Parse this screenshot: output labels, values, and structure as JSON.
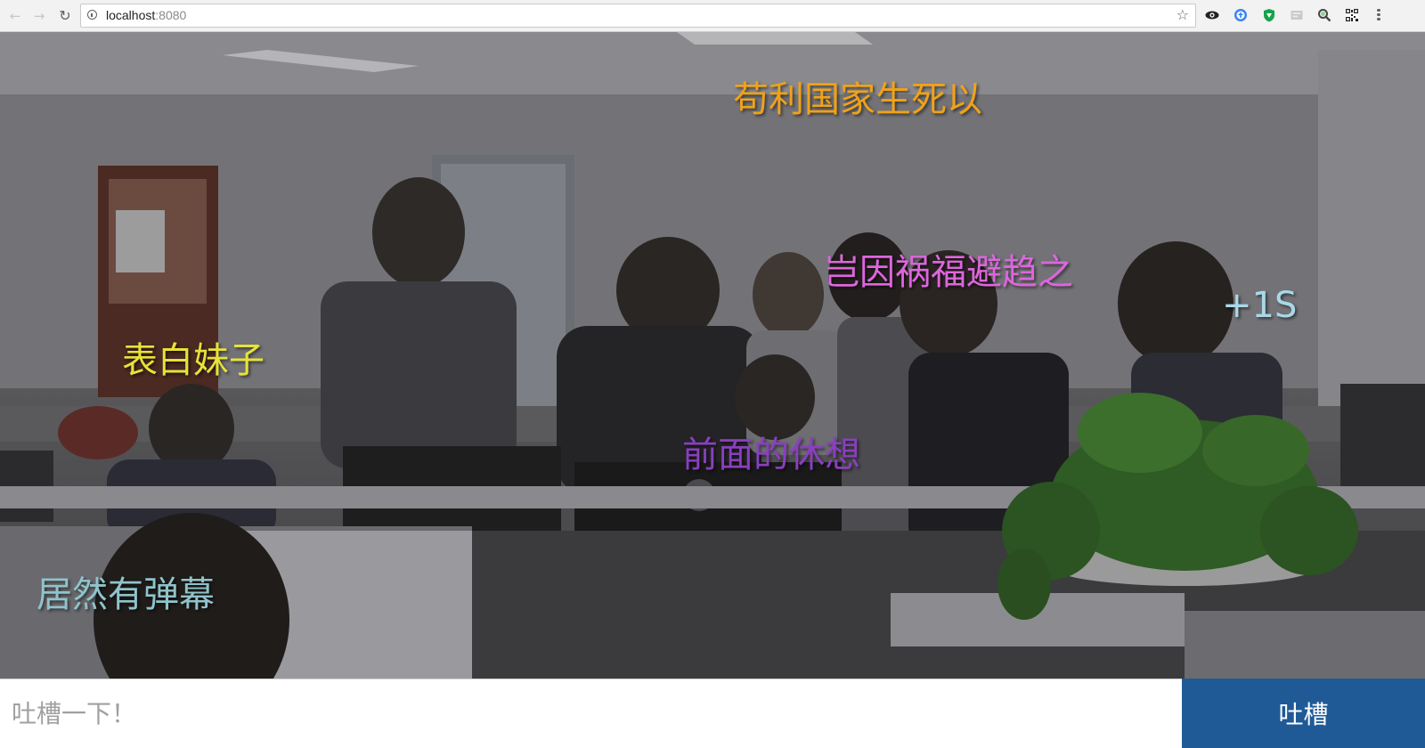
{
  "browser": {
    "address": "localhost",
    "port": ":8080",
    "star_icon": "star-icon",
    "extensions": [
      "eye-icon",
      "translate-icon",
      "shield-icon",
      "extension-icon",
      "zoom-icon",
      "qr-code-icon"
    ]
  },
  "danmaku": [
    {
      "text": "苟利国家生死以",
      "color": "#f0a21a"
    },
    {
      "text": "岂因祸福避趋之",
      "color": "#dd66dd"
    },
    {
      "text": "+1S",
      "color": "#a8d8e8"
    },
    {
      "text": "表白妹子",
      "color": "#e6e23a"
    },
    {
      "text": "前面的休想",
      "color": "#8a3fbf"
    },
    {
      "text": "居然有弹幕",
      "color": "#8fc3cb"
    }
  ],
  "comment": {
    "placeholder": "吐槽一下！",
    "value": "",
    "submit_label": "吐槽"
  },
  "colors": {
    "submit_bg": "#1f5a96",
    "shield_green": "#16a34a"
  }
}
